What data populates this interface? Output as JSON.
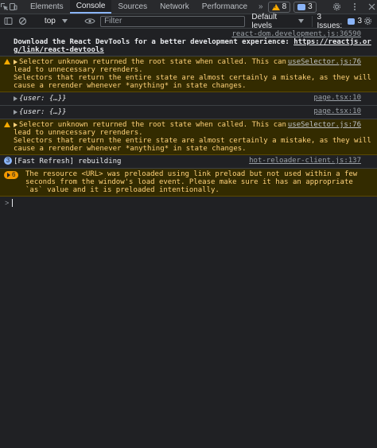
{
  "tabs": [
    "Elements",
    "Console",
    "Sources",
    "Network",
    "Performance"
  ],
  "active_tab": "Console",
  "more_tabs": "»",
  "warnings_count": "8",
  "messages_count": "3",
  "toolbar": {
    "context": "top",
    "filter_placeholder": "Filter",
    "levels": "Default levels",
    "issues_label": "3 Issues:",
    "issues_count": "3"
  },
  "messages": [
    {
      "type": "info",
      "source": "react-dom.development.js:36590",
      "text": "Download the React DevTools for a better development experience: ",
      "link": "https://reactjs.org/link/react-devtools"
    },
    {
      "type": "warning",
      "source": "useSelector.js:76",
      "line1": "Selector unknown returned the root state when called. This can lead to unnecessary rerenders.",
      "line2": "Selectors that return the entire state are almost certainly a mistake, as they will cause a rerender whenever *anything* in state changes."
    },
    {
      "type": "log",
      "source": "page.tsx:10",
      "text": "{user: {…}}"
    },
    {
      "type": "log",
      "source": "page.tsx:10",
      "text": "{user: {…}}"
    },
    {
      "type": "warning",
      "source": "useSelector.js:76",
      "line1": "Selector unknown returned the root state when called. This can lead to unnecessary rerenders.",
      "line2": "Selectors that return the entire state are almost certainly a mistake, as they will cause a rerender whenever *anything* in state changes."
    },
    {
      "type": "info-count",
      "count": "3",
      "source": "hot-reloader-client.js:137",
      "text": "[Fast Refresh] rebuilding"
    },
    {
      "type": "warning-count",
      "count": "6",
      "text": "The resource <URL> was preloaded using link preload but not used within a few seconds from the window's load event. Please make sure it has an appropriate `as` value and it is preloaded intentionally."
    }
  ],
  "prompt_symbol": ">"
}
